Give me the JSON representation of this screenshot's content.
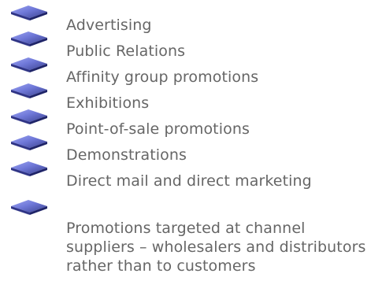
{
  "bullet_list": {
    "items": [
      {
        "label": "Advertising",
        "icon": "diamond-bullet-icon"
      },
      {
        "label": "Public Relations",
        "icon": "diamond-bullet-icon"
      },
      {
        "label": "Affinity group promotions",
        "icon": "diamond-bullet-icon"
      },
      {
        "label": "Exhibitions",
        "icon": "diamond-bullet-icon"
      },
      {
        "label": "Point-of-sale promotions",
        "icon": "diamond-bullet-icon"
      },
      {
        "label": "Demonstrations",
        "icon": "diamond-bullet-icon"
      },
      {
        "label": "Direct mail and direct marketing",
        "icon": "diamond-bullet-icon"
      },
      {
        "label": "Promotions targeted at channel suppliers – wholesalers and distributors rather than to customers",
        "icon": "diamond-bullet-icon"
      }
    ],
    "colors": {
      "text": "#666666",
      "bullet_top": "#6f78d8",
      "bullet_side": "#2f3486",
      "bullet_shadow": "#b8bbd6"
    }
  }
}
